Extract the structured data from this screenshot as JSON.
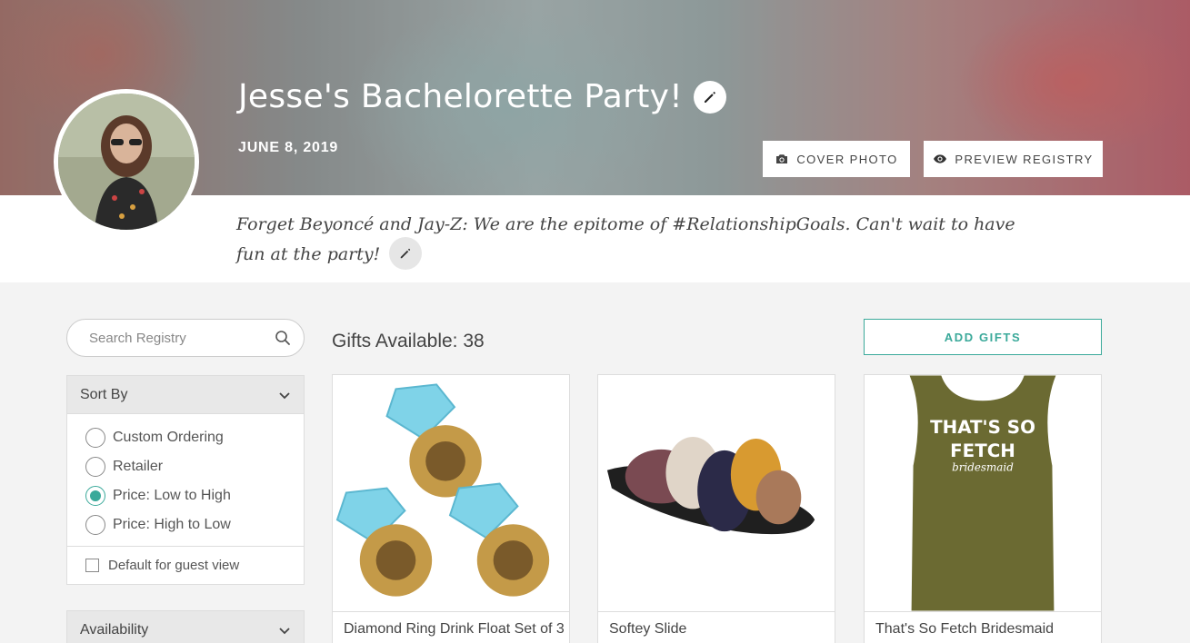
{
  "event": {
    "title": "Jesse's Bachelorette Party!",
    "date": "JUNE 8, 2019",
    "description": "Forget Beyoncé and Jay-Z: We are the epitome of #RelationshipGoals. Can't wait to have fun at the party!"
  },
  "header_buttons": {
    "cover_photo": "COVER PHOTO",
    "preview_registry": "PREVIEW REGISTRY"
  },
  "search": {
    "placeholder": "Search Registry"
  },
  "sort": {
    "heading": "Sort By",
    "options": [
      "Custom Ordering",
      "Retailer",
      "Price: Low to High",
      "Price: High to Low"
    ],
    "selected": "Price: Low to High",
    "default_guest_view_label": "Default for guest view"
  },
  "availability": {
    "heading": "Availability"
  },
  "gifts": {
    "count_label": "Gifts Available: 38",
    "add_label": "ADD GIFTS",
    "items": [
      {
        "name": "Diamond Ring Drink Float Set of 3"
      },
      {
        "name": "Softey Slide"
      },
      {
        "name": "That's So Fetch Bridesmaid"
      }
    ]
  },
  "product_print": {
    "line1": "THAT'S SO",
    "line2": "FETCH",
    "line3": "bridesmaid"
  },
  "colors": {
    "accent": "#3aa99a",
    "panel_header": "#e8e8e8",
    "page_bg": "#f3f3f3"
  }
}
